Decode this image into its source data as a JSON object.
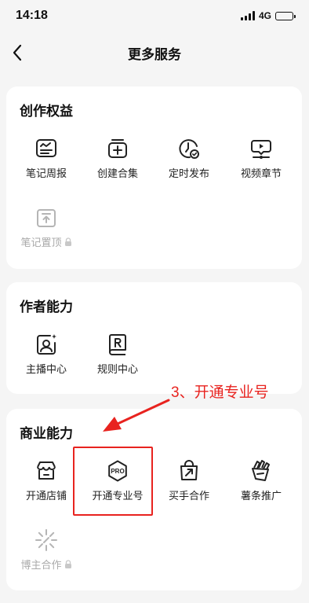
{
  "status_bar": {
    "time": "14:18",
    "network": "4G"
  },
  "nav": {
    "title": "更多服务"
  },
  "sections": {
    "creation": {
      "title": "创作权益",
      "items": [
        "笔记周报",
        "创建合集",
        "定时发布",
        "视频章节",
        "笔记置顶"
      ]
    },
    "author": {
      "title": "作者能力",
      "items": [
        "主播中心",
        "规则中心"
      ]
    },
    "business": {
      "title": "商业能力",
      "items": [
        "开通店铺",
        "开通专业号",
        "买手合作",
        "薯条推广",
        "博主合作"
      ]
    }
  },
  "icon_text": {
    "pro": "PRO"
  },
  "annotation": {
    "text": "3、开通专业号",
    "color": "#e8231f"
  }
}
